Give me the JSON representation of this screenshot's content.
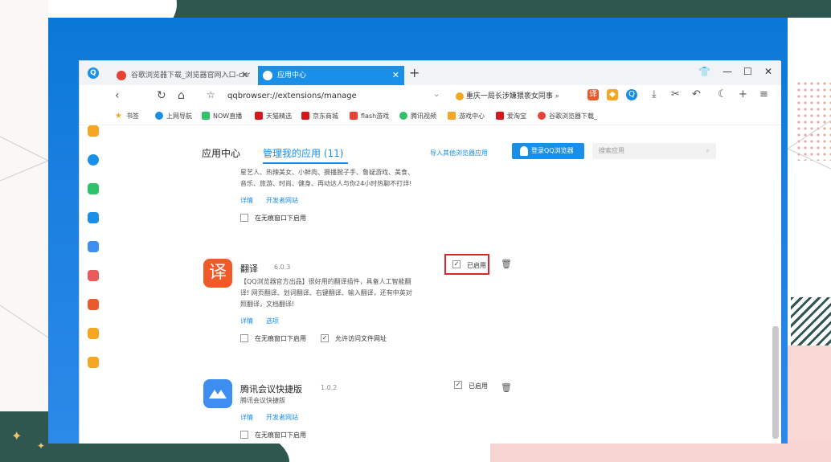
{
  "browser": {
    "tabs": [
      {
        "label": "谷歌浏览器下载_浏览器官网入口-chr",
        "active": false
      },
      {
        "label": "应用中心",
        "active": true
      }
    ],
    "new_tab": "+",
    "address": "qqbrowser://extensions/manage",
    "search_text": "重庆一局长涉嫌猥亵女同事",
    "window_controls": [
      "衬",
      "—",
      "☐",
      "✕"
    ]
  },
  "bookmarks": [
    "书签",
    "上网导航",
    "NOW直播",
    "天猫精选",
    "京东商城",
    "flash游戏",
    "腾讯视频",
    "游戏中心",
    "爱淘宝",
    "谷歌浏览器下载_"
  ],
  "page": {
    "title": "应用中心",
    "subtitle": "管理我的应用 (11)",
    "import_link": "导入其他浏览器应用",
    "login_button": "登录QQ浏览器",
    "search_placeholder": "搜索应用"
  },
  "ext_top": {
    "desc_line1": "星艺人、热辣美女、小鲜肉、摄播腕子手、鲁疑游戏、美食、",
    "desc_line2": "音乐、旅游、时尚、健身、再动达人与你24小时热聊不打烊!",
    "detail_link": "详情",
    "dev_link": "开发者网站",
    "incognito_label": "在无痕窗口下启用"
  },
  "ext_translate": {
    "icon_char": "译",
    "name": "翻译",
    "version": "6.0.3",
    "desc_line1": "【QQ浏览器官方出品】很好用的翻译插件，具备人工智能翻",
    "desc_line2": "译! 网页翻译、划词翻译、右键翻译、输入翻译，还有中英对",
    "desc_line3": "照翻译，文档翻译!",
    "detail_link": "详情",
    "options_link": "选项",
    "enabled_label": "已启用",
    "incognito_label": "在无痕窗口下启用",
    "file_access_label": "允许访问文件网址"
  },
  "ext_meeting": {
    "name": "腾讯会议快捷版",
    "version": "1.0.2",
    "desc": "腾讯会议快捷版",
    "detail_link": "详情",
    "dev_link": "开发者网站",
    "enabled_label": "已启用",
    "incognito_label": "在无痕窗口下启用"
  },
  "colors": {
    "accent": "#1a8fe8",
    "highlight": "#d9262c",
    "translate_icon": "#f05a28",
    "meeting_icon": "#3d8ef0"
  }
}
